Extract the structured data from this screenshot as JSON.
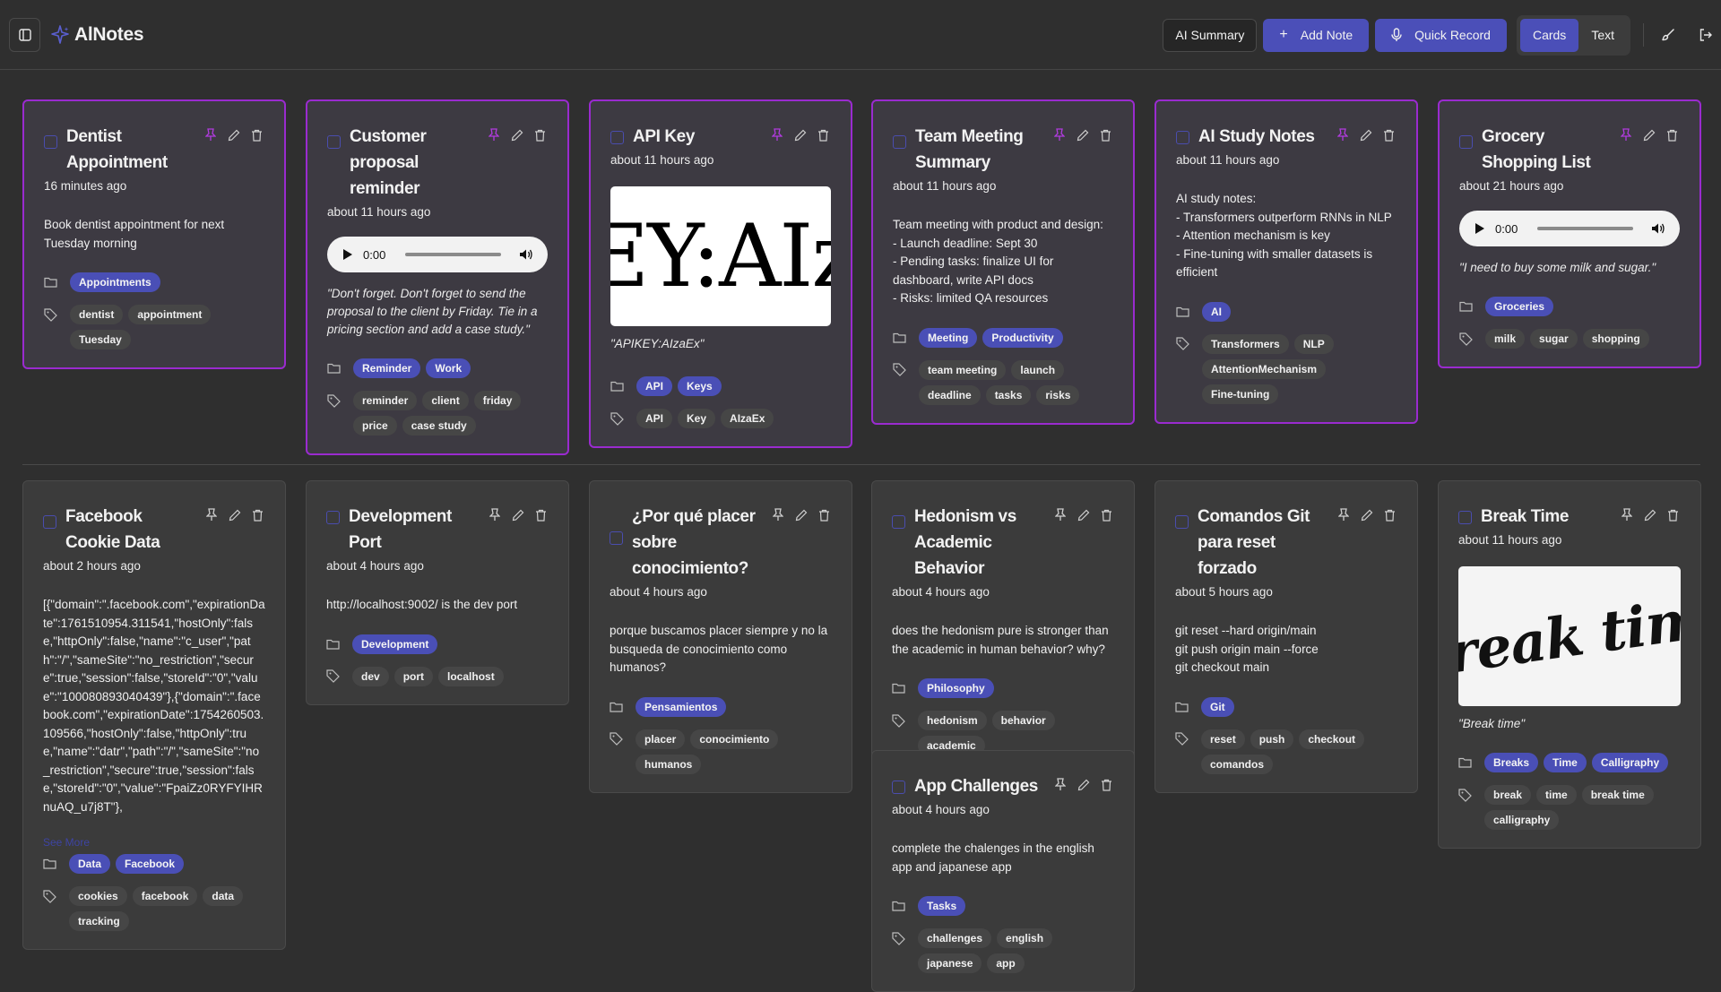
{
  "app": {
    "title": "AlNotes"
  },
  "header": {
    "ai_summary": "AI Summary",
    "add_note": "Add Note",
    "quick_record": "Quick Record",
    "view_cards": "Cards",
    "view_text": "Text"
  },
  "colors": {
    "accent": "#4b4fb8",
    "pinned_border": "#9a2bcf",
    "background": "#2f2f2f",
    "card": "#3b3b3b"
  },
  "notes": [
    {
      "title": "Dentist Appointment",
      "time": "16 minutes ago",
      "body": "Book dentist appointment for next Tuesday morning",
      "categories": [
        "Appointments"
      ],
      "tags": [
        "dentist",
        "appointment",
        "Tuesday"
      ]
    },
    {
      "title": "Customer proposal reminder",
      "time": "about 11 hours ago",
      "audio_time": "0:00",
      "quote": "\"Don't forget. Don't forget to send the proposal to the client by Friday. Tie in a pricing section and add a case study.\"",
      "categories": [
        "Reminder",
        "Work"
      ],
      "tags": [
        "reminder",
        "client",
        "friday",
        "price",
        "case study"
      ]
    },
    {
      "title": "API Key",
      "time": "about 11 hours ago",
      "image_text": "EY:AIz",
      "quote": "\"APIKEY:AIzaEx\"",
      "categories": [
        "API",
        "Keys"
      ],
      "tags": [
        "API",
        "Key",
        "AIzaEx"
      ]
    },
    {
      "title": "Team Meeting Summary",
      "time": "about 11 hours ago",
      "body": "Team meeting with product and design:\n- Launch deadline: Sept 30\n- Pending tasks: finalize UI for dashboard, write API docs\n- Risks: limited QA resources",
      "categories": [
        "Meeting",
        "Productivity"
      ],
      "tags": [
        "team meeting",
        "launch",
        "deadline",
        "tasks",
        "risks"
      ]
    },
    {
      "title": "AI Study Notes",
      "time": "about 11 hours ago",
      "body": "AI study notes:\n- Transformers outperform RNNs in NLP\n- Attention mechanism is key\n- Fine-tuning with smaller datasets is efficient",
      "categories": [
        "AI"
      ],
      "tags": [
        "Transformers",
        "NLP",
        "AttentionMechanism",
        "Fine-tuning"
      ]
    },
    {
      "title": "Grocery Shopping List",
      "time": "about 21 hours ago",
      "audio_time": "0:00",
      "quote": "\"I need to buy some milk and sugar.\"",
      "categories": [
        "Groceries"
      ],
      "tags": [
        "milk",
        "sugar",
        "shopping"
      ]
    },
    {
      "title": "Facebook Cookie Data",
      "time": "about 2 hours ago",
      "body": "[{\"domain\":\".facebook.com\",\"expirationDate\":1761510954.311541,\"hostOnly\":false,\"httpOnly\":false,\"name\":\"c_user\",\"path\":\"/\",\"sameSite\":\"no_restriction\",\"secure\":true,\"session\":false,\"storeId\":\"0\",\"value\":\"100080893040439\"},{\"domain\":\".facebook.com\",\"expirationDate\":1754260503.109566,\"hostOnly\":false,\"httpOnly\":true,\"name\":\"datr\",\"path\":\"/\",\"sameSite\":\"no_restriction\",\"secure\":true,\"session\":false,\"storeId\":\"0\",\"value\":\"FpaiZz0RYFYIHRnuAQ_u7j8T\"},",
      "see_more": "See More",
      "categories": [
        "Data",
        "Facebook"
      ],
      "tags": [
        "cookies",
        "facebook",
        "data",
        "tracking"
      ]
    },
    {
      "title": "Development Port",
      "time": "about 4 hours ago",
      "body": "http://localhost:9002/ is the dev port",
      "categories": [
        "Development"
      ],
      "tags": [
        "dev",
        "port",
        "localhost"
      ]
    },
    {
      "title": "¿Por qué placer sobre conocimiento?",
      "time": "about 4 hours ago",
      "body": "porque buscamos placer siempre y no la busqueda de conocimiento como humanos?",
      "categories": [
        "Pensamientos"
      ],
      "tags": [
        "placer",
        "conocimiento",
        "humanos"
      ]
    },
    {
      "title": "Hedonism vs Academic Behavior",
      "time": "about 4 hours ago",
      "body": "does the hedonism pure is stronger than the academic in human behavior? why?",
      "categories": [
        "Philosophy"
      ],
      "tags": [
        "hedonism",
        "behavior",
        "academic"
      ]
    },
    {
      "title": "App Challenges",
      "time": "about 4 hours ago",
      "body": "complete the chalenges in the english app and japanese app",
      "categories": [
        "Tasks"
      ],
      "tags": [
        "challenges",
        "english",
        "japanese",
        "app"
      ]
    },
    {
      "title": "Comandos Git para reset forzado",
      "time": "about 5 hours ago",
      "body": "git reset --hard origin/main\ngit push origin main --force\ngit checkout main",
      "categories": [
        "Git"
      ],
      "tags": [
        "reset",
        "push",
        "checkout",
        "comandos"
      ]
    },
    {
      "title": "Break Time",
      "time": "about 11 hours ago",
      "image_text": "Break time",
      "quote": "\"Break time\"",
      "categories": [
        "Breaks",
        "Time",
        "Calligraphy"
      ],
      "tags": [
        "break",
        "time",
        "break time",
        "calligraphy"
      ]
    }
  ]
}
